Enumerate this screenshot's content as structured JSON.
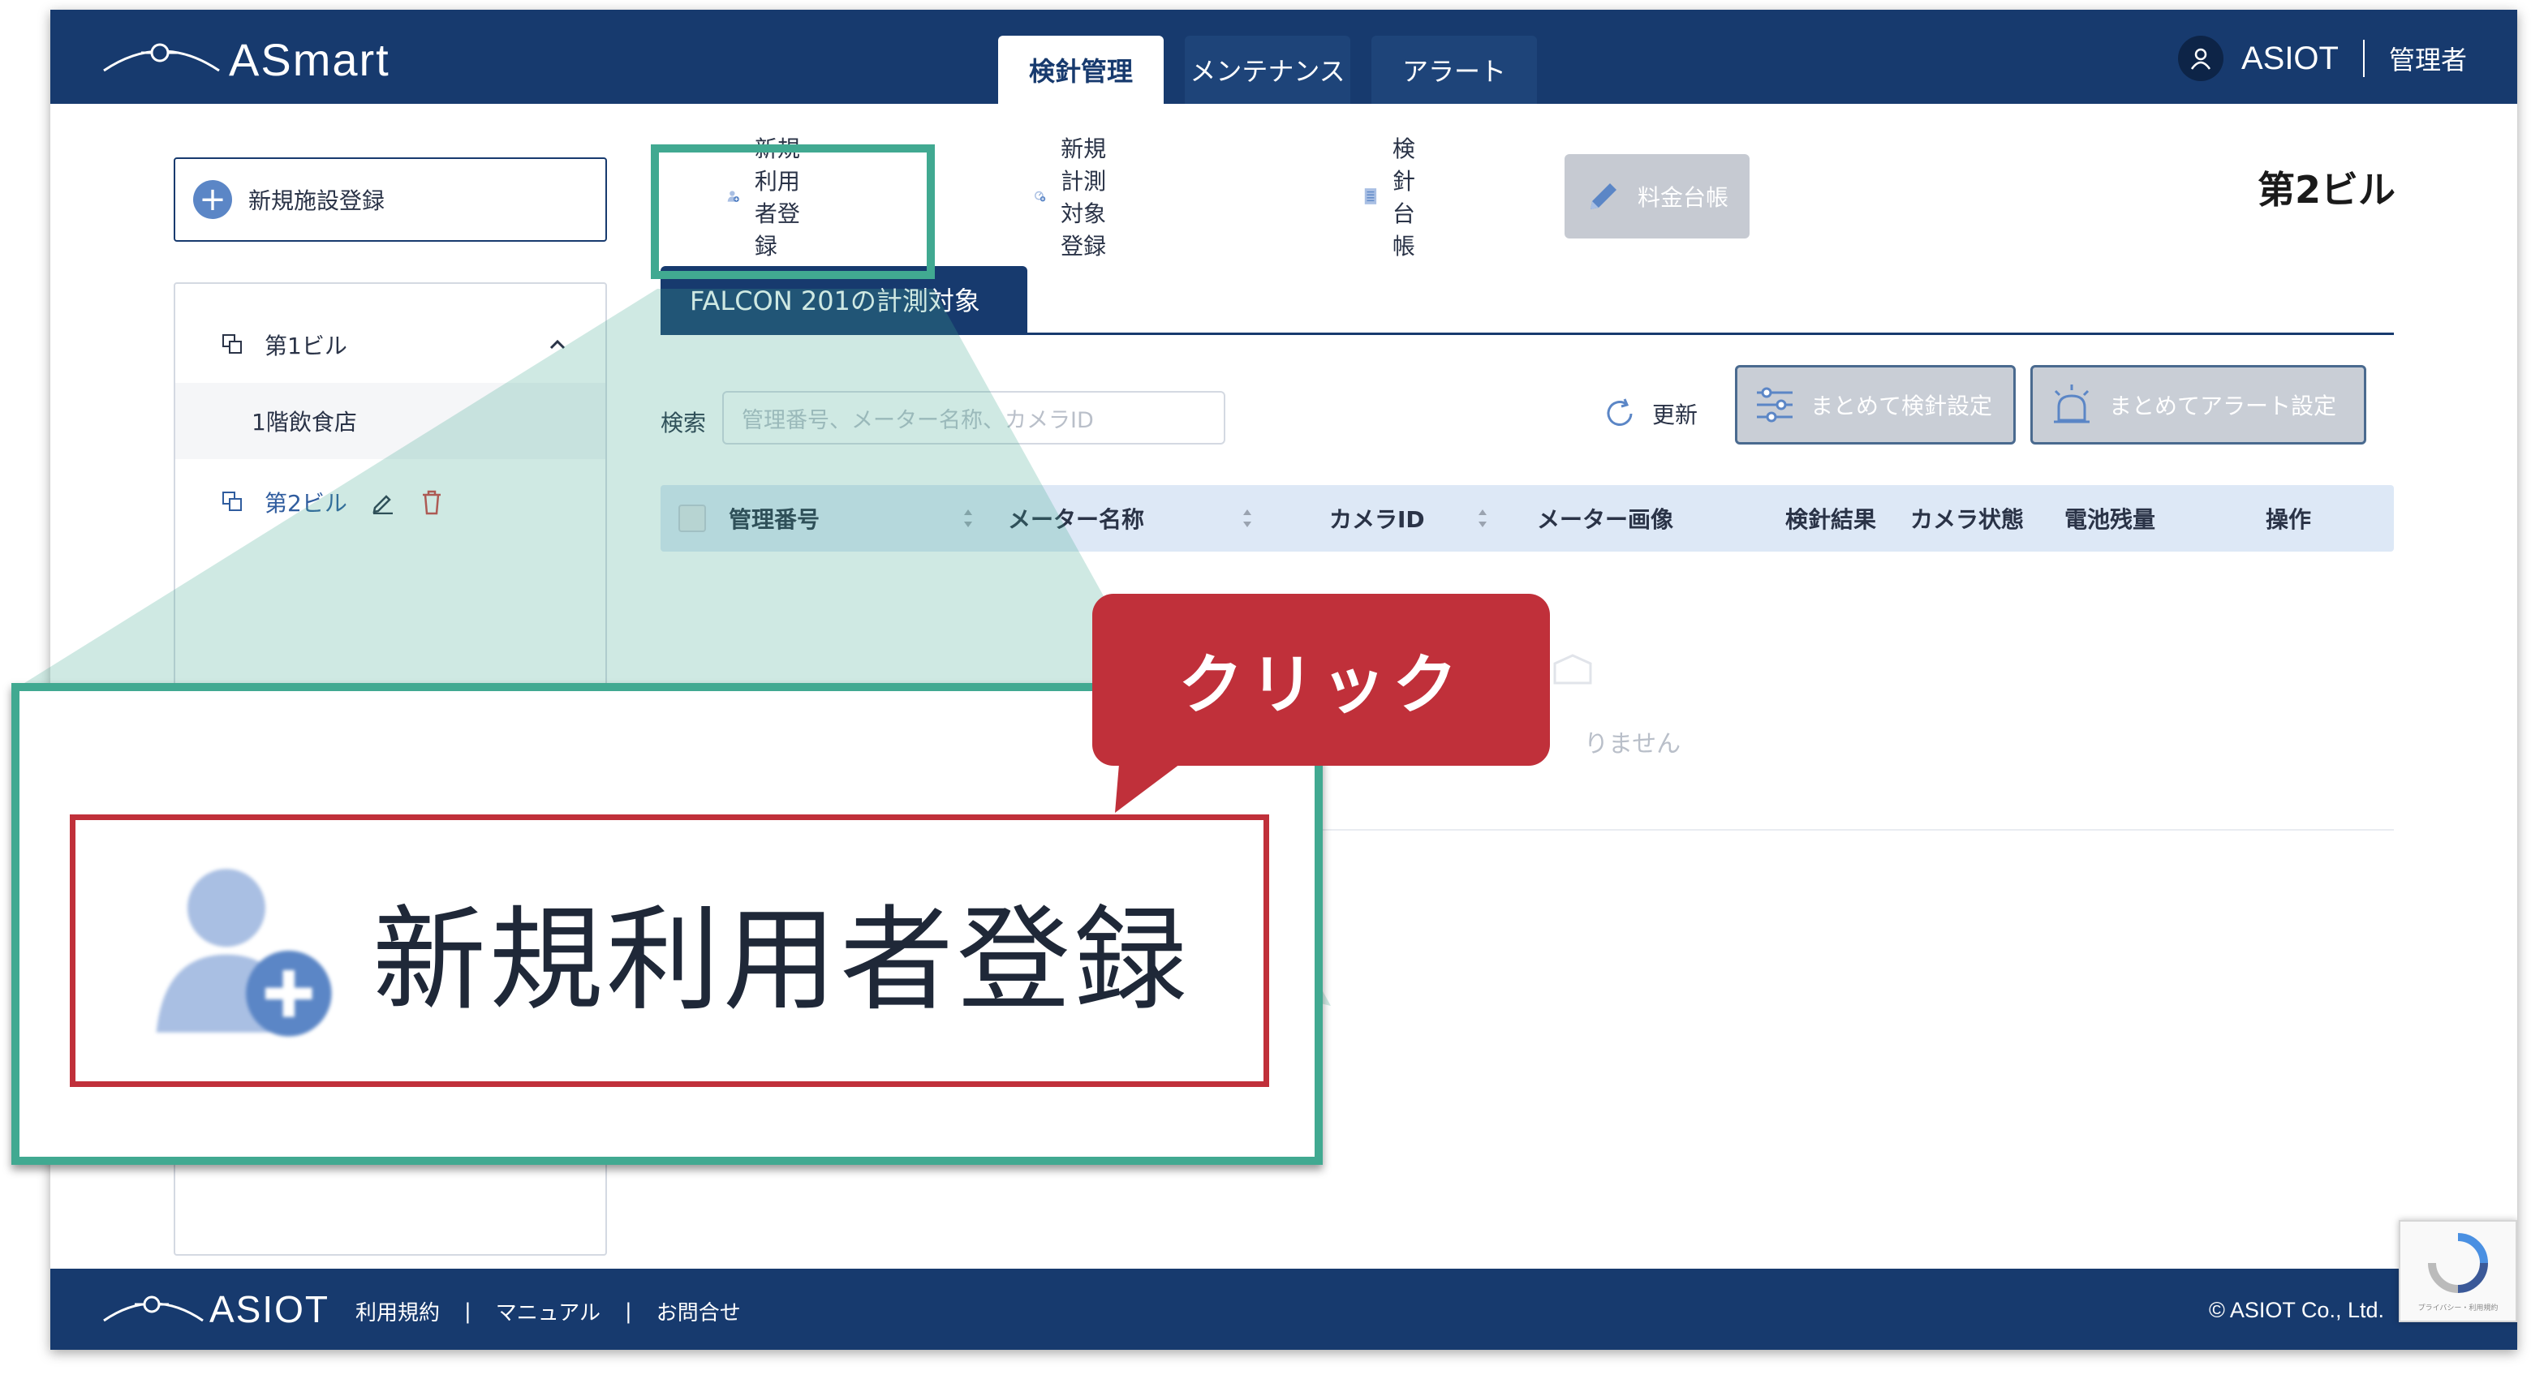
{
  "app": {
    "brand": "ASmart"
  },
  "nav": {
    "tabs": [
      {
        "label": "検針管理"
      },
      {
        "label": "メンテナンス"
      },
      {
        "label": "アラート"
      }
    ]
  },
  "user": {
    "name": "ASIOT",
    "role": "管理者"
  },
  "sidebar": {
    "add_facility_label": "新規施設登録",
    "tree": [
      {
        "label": "第1ビル"
      },
      {
        "label": "1階飲食店"
      },
      {
        "label": "第2ビル"
      }
    ]
  },
  "actions": {
    "new_user": "新規利用者登録",
    "new_target": "新規計測対象登録",
    "ledger": "検針台帳",
    "fee_ledger": "料金台帳"
  },
  "building_title": "第2ビル",
  "subtab_label": "FALCON 201の計測対象",
  "search": {
    "label": "検索",
    "placeholder": "管理番号、メーター名称、カメラID"
  },
  "toolbar": {
    "refresh": "更新",
    "bulk_reading": "まとめて検針設定",
    "bulk_alert": "まとめてアラート設定"
  },
  "table": {
    "columns": [
      "管理番号",
      "メーター名称",
      "カメラID",
      "メーター画像",
      "検針結果",
      "カメラ状態",
      "電池残量",
      "操作"
    ],
    "empty_text": "りません"
  },
  "footer": {
    "brand": "ASIOT",
    "links": [
      "利用規約",
      "マニュアル",
      "お問合せ"
    ],
    "separator": "|",
    "copyright": "© ASIOT Co., Ltd."
  },
  "recaptcha": {
    "text": "プライバシー・利用規約"
  },
  "annotation": {
    "callout": "クリック",
    "zoom_label": "新規利用者登録"
  },
  "colors": {
    "navy": "#173a6e",
    "teal": "#41a991",
    "red": "#c0303a",
    "table_header": "#dde8f6"
  }
}
